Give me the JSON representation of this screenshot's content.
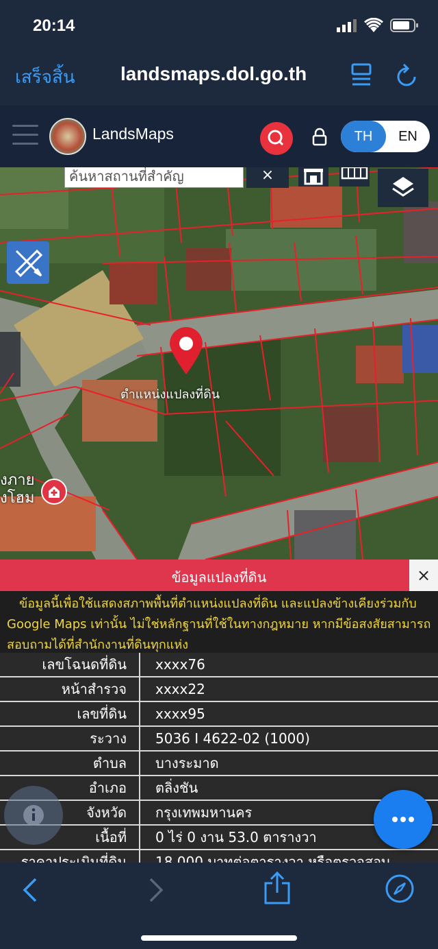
{
  "status": {
    "time": "20:14"
  },
  "browser": {
    "done_label": "เสร็จสิ้น",
    "url": "landsmaps.dol.go.th"
  },
  "app": {
    "title": "LandsMaps",
    "lang_th": "TH",
    "lang_en": "EN"
  },
  "map": {
    "search_placeholder": "ค้นหาสถานที่สำคัญ",
    "clear_label": "×",
    "pin_label": "ตำแหน่งแปลงที่ดิน",
    "poi_label_1": "งภาย",
    "poi_label_2": "งโฮม"
  },
  "panel": {
    "title": "ข้อมูลแปลงที่ดิน",
    "close_label": "×",
    "notice": "ข้อมูลนี้เพื่อใช้แสดงสภาพพื้นที่ตำแหน่งแปลงที่ดิน และแปลงข้างเคียงร่วมกับ Google Maps เท่านั้น ไม่ใช่หลักฐานที่ใช้ในทางกฎหมาย หากมีข้อสงสัยสามารถสอบถามได้ที่สำนักงานที่ดินทุกแห่ง",
    "rows": [
      {
        "label": "เลขโฉนดที่ดิน",
        "value": "xxxx76"
      },
      {
        "label": "หน้าสำรวจ",
        "value": "xxxx22"
      },
      {
        "label": "เลขที่ดิน",
        "value": "xxxx95"
      },
      {
        "label": "ระวาง",
        "value": "5036 I 4622-02 (1000)"
      },
      {
        "label": "ตำบล",
        "value": "บางระมาด"
      },
      {
        "label": "อำเภอ",
        "value": "ตลิ่งชัน"
      },
      {
        "label": "จังหวัด",
        "value": "กรุงเทพมหานคร"
      },
      {
        "label": "เนื้อที่",
        "value": "0 ไร่ 0 งาน 53.0 ตารางวา"
      },
      {
        "label": "ราคาประเมินที่ดิน",
        "value": "18,000 บาทต่อตารางวา หรือตรวจสอบ"
      }
    ]
  },
  "colors": {
    "accent": "#2c80d8",
    "danger": "#e0364d",
    "notice_text": "#f0d640",
    "fab": "#1a7df0"
  }
}
